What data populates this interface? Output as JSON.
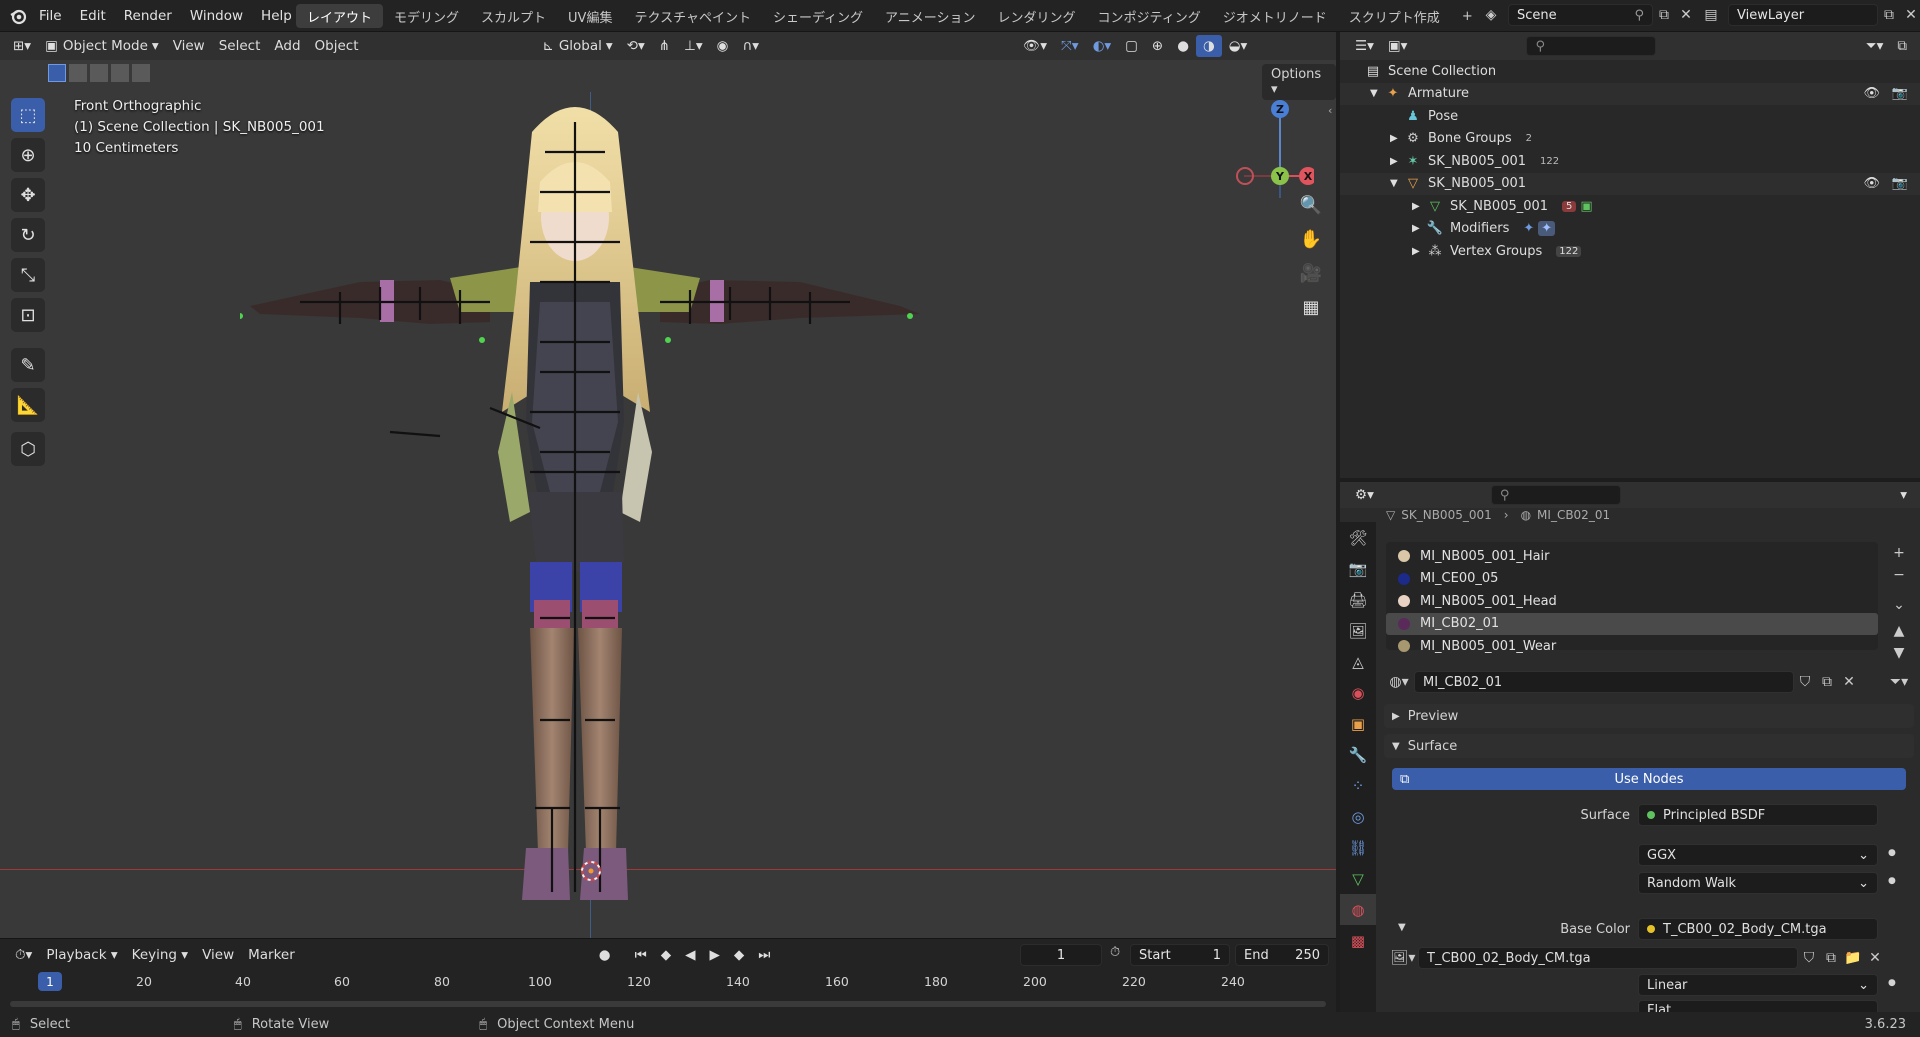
{
  "topbar": {
    "menus": [
      "File",
      "Edit",
      "Render",
      "Window",
      "Help"
    ],
    "workspaces": [
      "レイアウト",
      "モデリング",
      "スカルプト",
      "UV編集",
      "テクスチャペイント",
      "シェーディング",
      "アニメーション",
      "レンダリング",
      "コンポジティング",
      "ジオメトリノード",
      "スクリプト作成"
    ],
    "add_tab": "+",
    "scene": "Scene",
    "view_layer": "ViewLayer"
  },
  "viewport": {
    "mode": "Object Mode",
    "menus": [
      "View",
      "Select",
      "Add",
      "Object"
    ],
    "orientation": "Global",
    "options": "Options",
    "overlay": {
      "view_name": "Front Orthographic",
      "collection": "(1) Scene Collection | SK_NB005_001",
      "scale": "10 Centimeters"
    },
    "gizmo": {
      "z": "Z",
      "y": "Y",
      "x": "X"
    }
  },
  "outliner": {
    "rows": [
      {
        "label": "Scene Collection",
        "icon": "collection-icon",
        "badge": ""
      },
      {
        "label": "Armature",
        "icon": "armature-icon",
        "badge": ""
      },
      {
        "label": "Pose",
        "icon": "pose-icon",
        "badge": ""
      },
      {
        "label": "Bone Groups",
        "icon": "bone-groups-icon",
        "badge": "2"
      },
      {
        "label": "SK_NB005_001",
        "icon": "armature-data-icon",
        "badge": "122"
      },
      {
        "label": "SK_NB005_001",
        "icon": "mesh-object-icon",
        "badge": ""
      },
      {
        "label": "SK_NB005_001",
        "icon": "mesh-data-icon",
        "badge": "5"
      },
      {
        "label": "Modifiers",
        "icon": "wrench-icon",
        "badge": ""
      },
      {
        "label": "Vertex Groups",
        "icon": "vertex-groups-icon",
        "badge": "122"
      }
    ]
  },
  "properties": {
    "breadcrumb": [
      "SK_NB005_001",
      "MI_CB02_01"
    ],
    "materials": [
      {
        "name": "MI_NB005_001_Hair",
        "color": "#d9c7a8"
      },
      {
        "name": "MI_CE00_05",
        "color": "#1c2a8a"
      },
      {
        "name": "MI_NB005_001_Head",
        "color": "#e8d2c4"
      },
      {
        "name": "MI_CB02_01",
        "color": "#5a2a5a"
      },
      {
        "name": "MI_NB005_001_Wear",
        "color": "#a89870"
      }
    ],
    "active_material": "MI_CB02_01",
    "preview_label": "Preview",
    "surface_label": "Surface",
    "use_nodes": "Use Nodes",
    "surface_field_label": "Surface",
    "surface_value": "Principled BSDF",
    "distribution": "GGX",
    "subsurface": "Random Walk",
    "base_color_label": "Base Color",
    "base_color_value": "T_CB00_02_Body_CM.tga",
    "image_name": "T_CB00_02_Body_CM.tga",
    "interpolation": "Linear",
    "projection": "Flat"
  },
  "timeline": {
    "menus": [
      "Playback",
      "Keying",
      "View",
      "Marker"
    ],
    "current_frame": "1",
    "start_label": "Start",
    "start": "1",
    "end_label": "End",
    "end": "250",
    "ticks": [
      "1",
      "20",
      "40",
      "60",
      "80",
      "100",
      "120",
      "140",
      "160",
      "180",
      "200",
      "220",
      "240"
    ]
  },
  "statusbar": {
    "select": "Select",
    "rotate": "Rotate View",
    "context": "Object Context Menu",
    "version": "3.6.23"
  },
  "colors": {
    "accent": "#3a5ea9",
    "selected_tool": "#3a5ea9"
  }
}
